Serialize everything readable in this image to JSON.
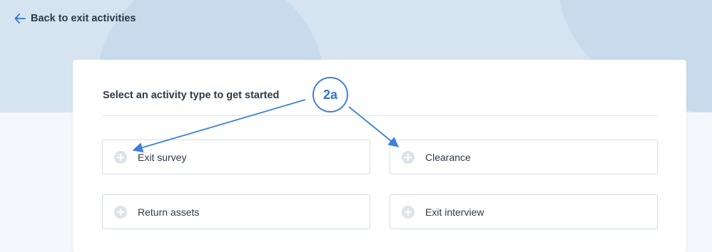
{
  "nav": {
    "back_label": "Back to exit activities",
    "back_icon": "arrow-left-icon"
  },
  "card": {
    "title": "Select an activity type to get started",
    "options": [
      {
        "label": "Exit survey",
        "icon": "plus-circle-icon"
      },
      {
        "label": "Clearance",
        "icon": "plus-circle-icon"
      },
      {
        "label": "Return assets",
        "icon": "plus-circle-icon"
      },
      {
        "label": "Exit interview",
        "icon": "plus-circle-icon"
      }
    ]
  },
  "annotation": {
    "callout_label": "2a",
    "color": "#3d7fe0"
  },
  "colors": {
    "accent": "#2f73d8",
    "hero_background": "#d6e4f1",
    "page_background": "#f3f7fb",
    "text": "#2d3a46"
  }
}
